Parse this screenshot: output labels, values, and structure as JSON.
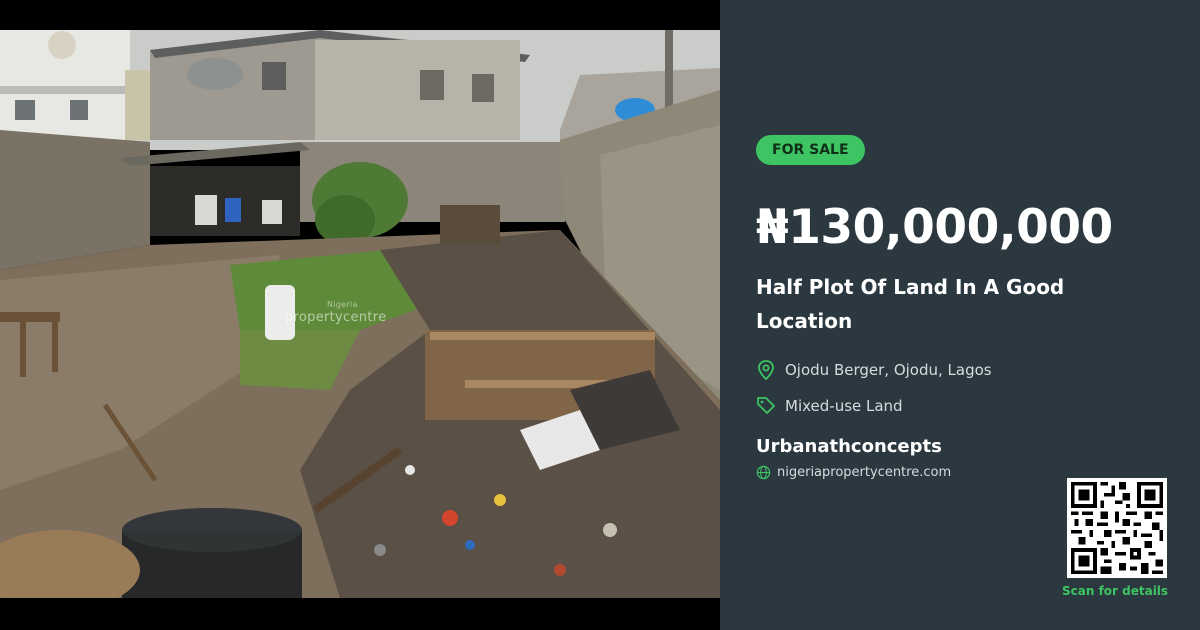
{
  "listing": {
    "badge": "FOR SALE",
    "price": "₦130,000,000",
    "title": "Half Plot Of Land In A Good Location",
    "location": "Ojodu Berger, Ojodu, Lagos",
    "property_type": "Mixed-use Land",
    "agent": "Urbanathconcepts",
    "website": "nigeriapropertycentre.com",
    "scan_label": "Scan for details"
  },
  "photo": {
    "watermark_small": "Nigeria",
    "watermark": "propertycentre"
  },
  "icons": {
    "location": "map-pin-icon",
    "type": "tag-icon",
    "website": "globe-icon"
  },
  "colors": {
    "panel_bg": "#2b3840",
    "accent_green": "#3ec462",
    "text_white": "#ffffff",
    "text_muted": "#d6dbde"
  }
}
